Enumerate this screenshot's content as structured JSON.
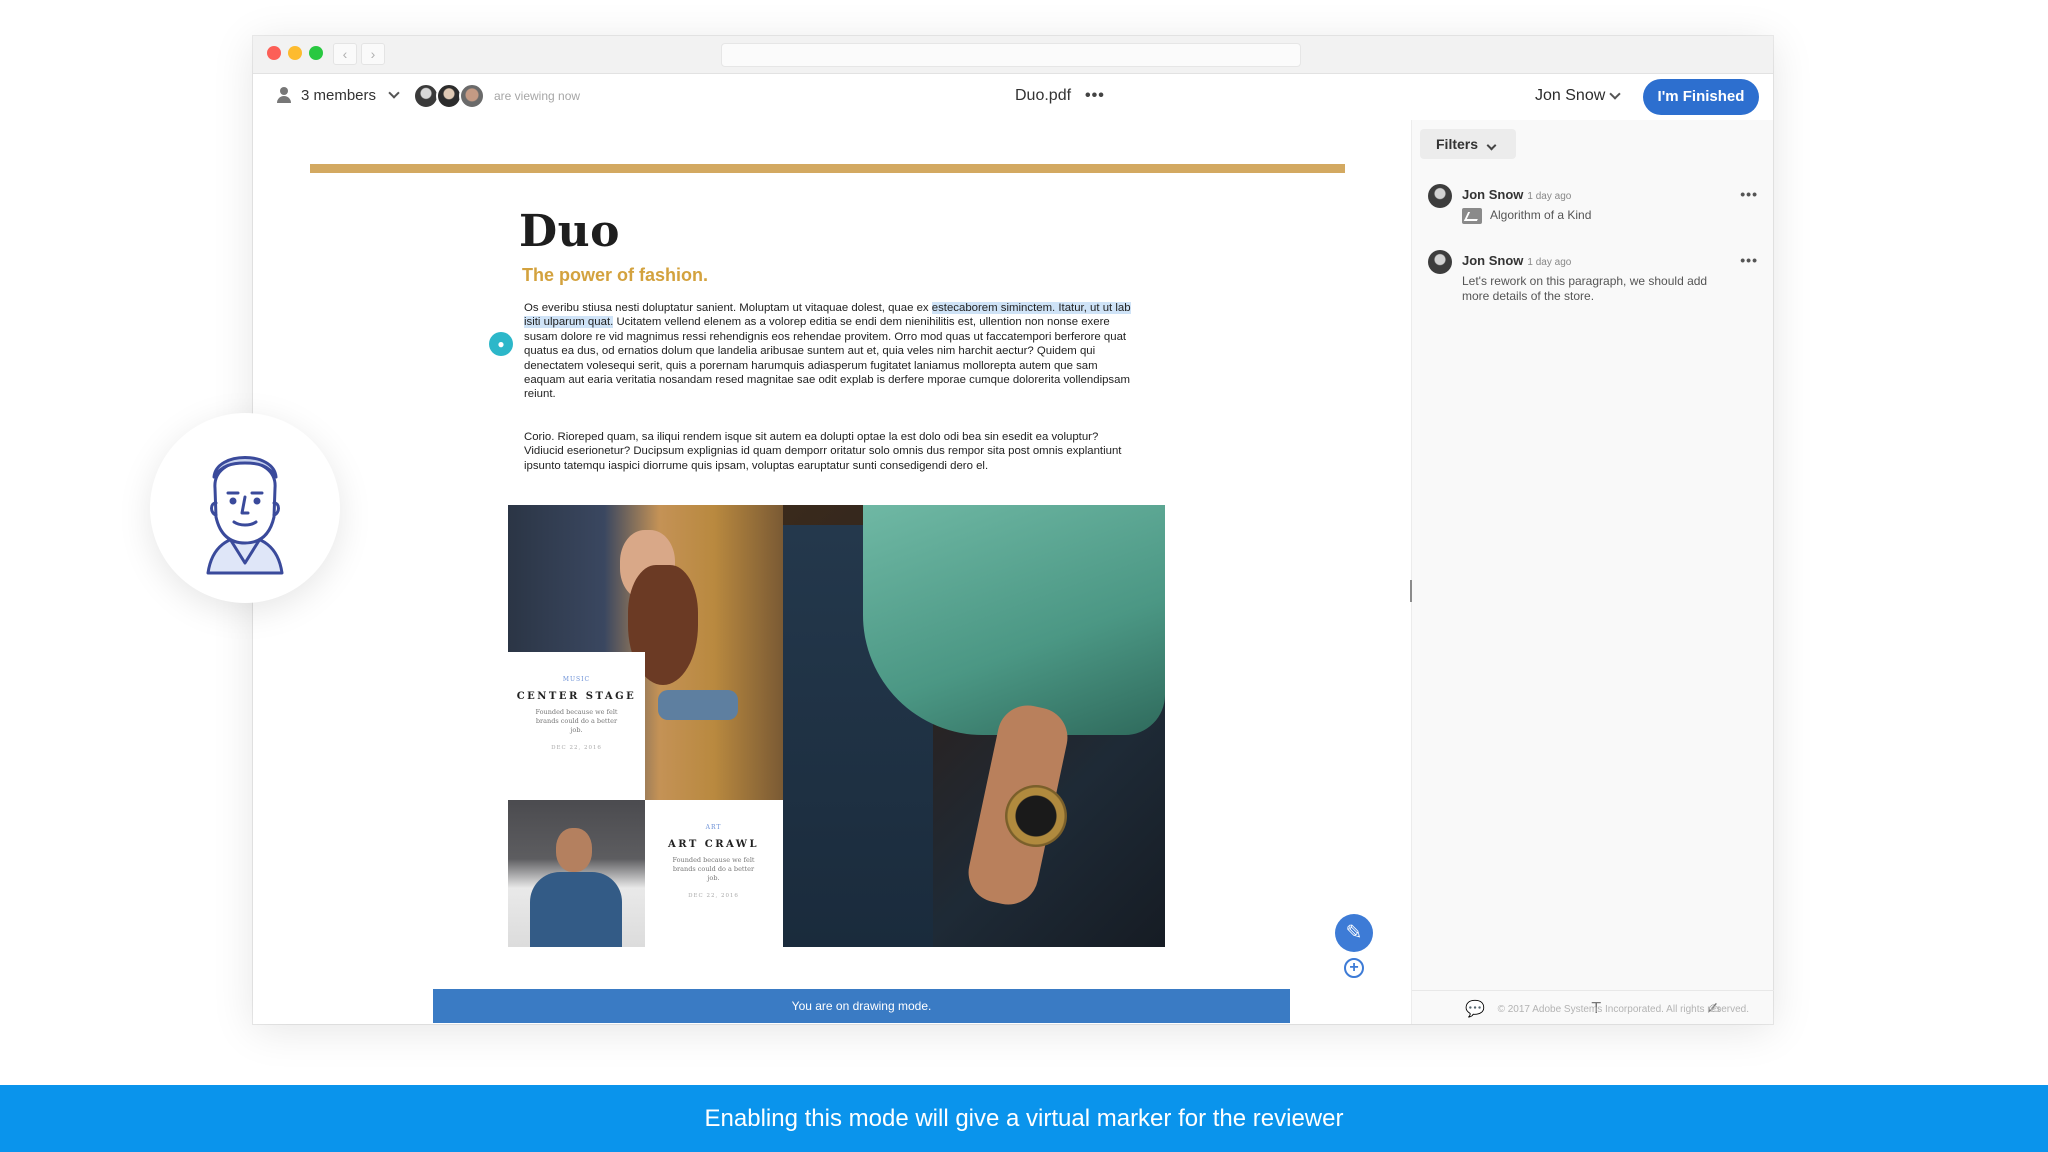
{
  "header": {
    "members_label": "3 members",
    "viewing_label": "are viewing now",
    "doc_name": "Duo.pdf",
    "more": "•••",
    "user_name": "Jon Snow",
    "finish_label": "I'm Finished"
  },
  "document": {
    "title": "Duo",
    "subtitle": "The power of fashion.",
    "para1_pre": "Os everibu stiusa nesti doluptatur sanient. Moluptam ut vitaquae dolest, quae ex ",
    "para1_highlight": "estecaborem siminctem. Itatur, ut ut lab isiti ulparum quat.",
    "para1_post": " Ucitatem vellend elenem as a volorep editia se endi dem nienihilitis est, ullention non nonse exere susam dolore re vid magnimus ressi rehendignis eos rehendae provitem. Orro mod quas ut faccatempori berferore quat quatus ea dus, od ernatios dolum que landelia aribusae suntem aut et, quia veles nim harchit aectur? Quidem qui denectatem volesequi serit, quis a porernam harumquis adiasperum fugitatet laniamus mollorepta autem que sam eaquam aut earia veritatia nosandam resed magnitae sae odit explab is derfere mporae cumque dolorerita vollendipsam reiunt.",
    "para2": "Corio. Rioreped quam, sa iliqui rendem isque sit autem ea dolupti optae la est dolo odi bea sin esedit ea voluptur? Vidiucid eserionetur? Ducipsum explignias id quam demporr oritatur solo omnis dus rempor sita post omnis explantiunt ipsunto tatemqu iaspici diorrume quis ipsam, voluptas earuptatur sunti consedigendi dero el.",
    "card1": {
      "tag": "MUSIC",
      "head": "CENTER STAGE",
      "desc": "Founded because we felt brands could do a better job.",
      "date": "DEC 22, 2016"
    },
    "card2": {
      "tag": "ART",
      "head": "ART CRAWL",
      "desc": "Founded because we felt brands could do a better job.",
      "date": "DEC 22, 2016"
    },
    "mode_banner": "You are on drawing mode."
  },
  "sidebar": {
    "filters_label": "Filters",
    "comments": [
      {
        "author": "Jon Snow",
        "time": "1 day ago",
        "body": "Algorithm of a Kind",
        "more": "•••"
      },
      {
        "author": "Jon Snow",
        "time": "1 day ago",
        "body": "Let's rework on this paragraph, we should add more details of the store.",
        "more": "•••"
      }
    ],
    "copyright": "© 2017 Adobe Systems Incorporated. All rights reserved."
  },
  "caption": "Enabling this mode will give a virtual marker for the reviewer",
  "colors": {
    "accent_blue": "#2d6fcf",
    "gold": "#d3a961",
    "banner_blue": "#3a7bc4",
    "caption_blue": "#0a94ec"
  },
  "icons": [
    "person-icon",
    "chevron-down-icon",
    "more-icon",
    "comment-icon",
    "pen-icon",
    "plus-icon",
    "text-tool-icon",
    "draw-tool-icon",
    "image-icon"
  ]
}
